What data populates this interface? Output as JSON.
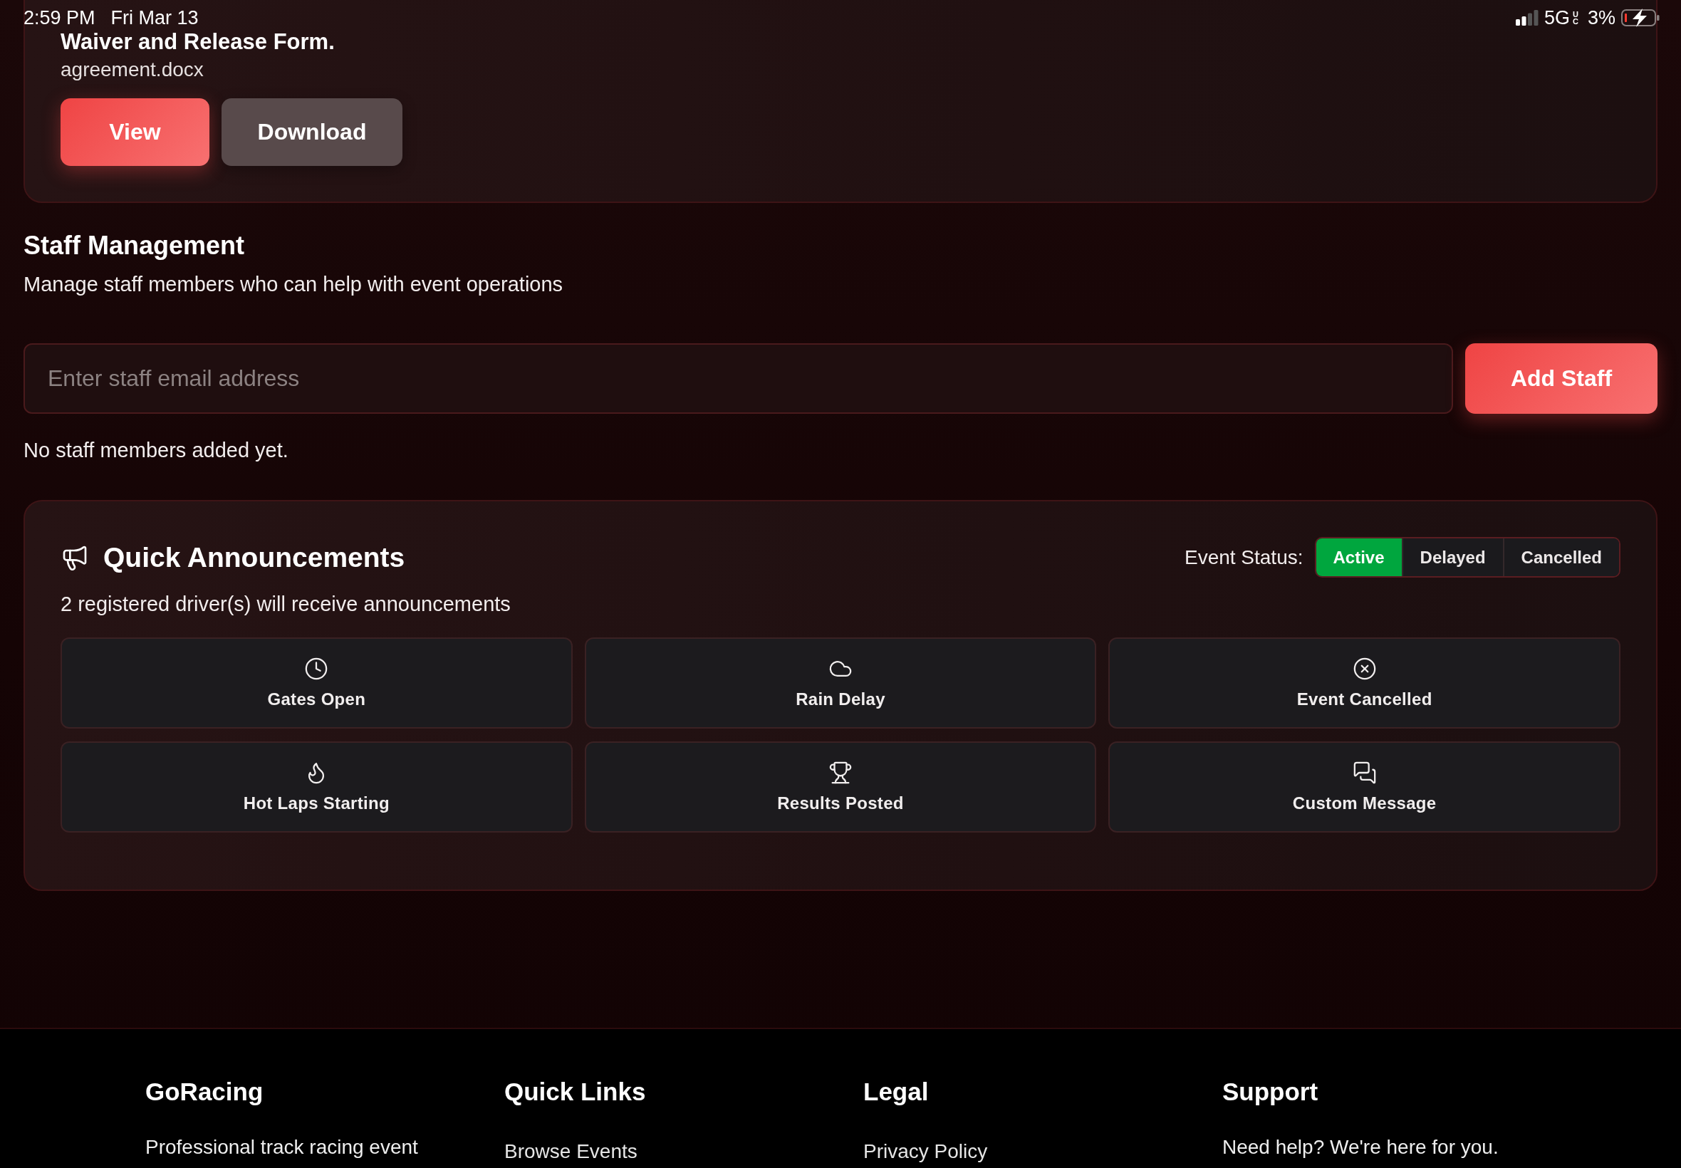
{
  "status_bar": {
    "time": "2:59 PM",
    "date": "Fri Mar 13",
    "network": "5G",
    "network_badge": "UC",
    "battery": "3%",
    "charging": true
  },
  "document_card": {
    "title": "Waiver and Release Form.",
    "file": "agreement.docx",
    "buttons": [
      {
        "label": "View",
        "kind": "primary"
      },
      {
        "label": "Download",
        "kind": "secondary"
      }
    ]
  },
  "staff_management": {
    "title": "Staff Management",
    "description": "Manage staff members who can help with event operations",
    "email_field": {
      "placeholder": "Enter staff email address"
    },
    "add_button": "Add Staff",
    "empty_message": "No staff members added yet."
  },
  "quick_announcements": {
    "title": "Quick Announcements",
    "event_status": {
      "label": "Event Status:",
      "options": [
        {
          "label": "Active",
          "selected": true
        },
        {
          "label": "Delayed",
          "selected": false
        },
        {
          "label": "Cancelled",
          "selected": false
        }
      ]
    },
    "recipients": "2 registered driver(s) will receive announcements",
    "actions": [
      {
        "label": "Gates Open",
        "kind": "gates"
      },
      {
        "label": "Rain Delay",
        "kind": "rain"
      },
      {
        "label": "Event Cancelled",
        "kind": "cancelled"
      },
      {
        "label": "Hot Laps Starting",
        "kind": "hotlaps"
      },
      {
        "label": "Results Posted",
        "kind": "results"
      },
      {
        "label": "Custom Message",
        "kind": "custom"
      }
    ]
  },
  "footer": {
    "columns": [
      {
        "title": "GoRacing",
        "text": "Professional track racing event"
      },
      {
        "title": "Quick Links",
        "links": [
          "Browse Events"
        ]
      },
      {
        "title": "Legal",
        "links": [
          "Privacy Policy"
        ]
      },
      {
        "title": "Support",
        "text": "Need help? We're here for you."
      }
    ]
  }
}
